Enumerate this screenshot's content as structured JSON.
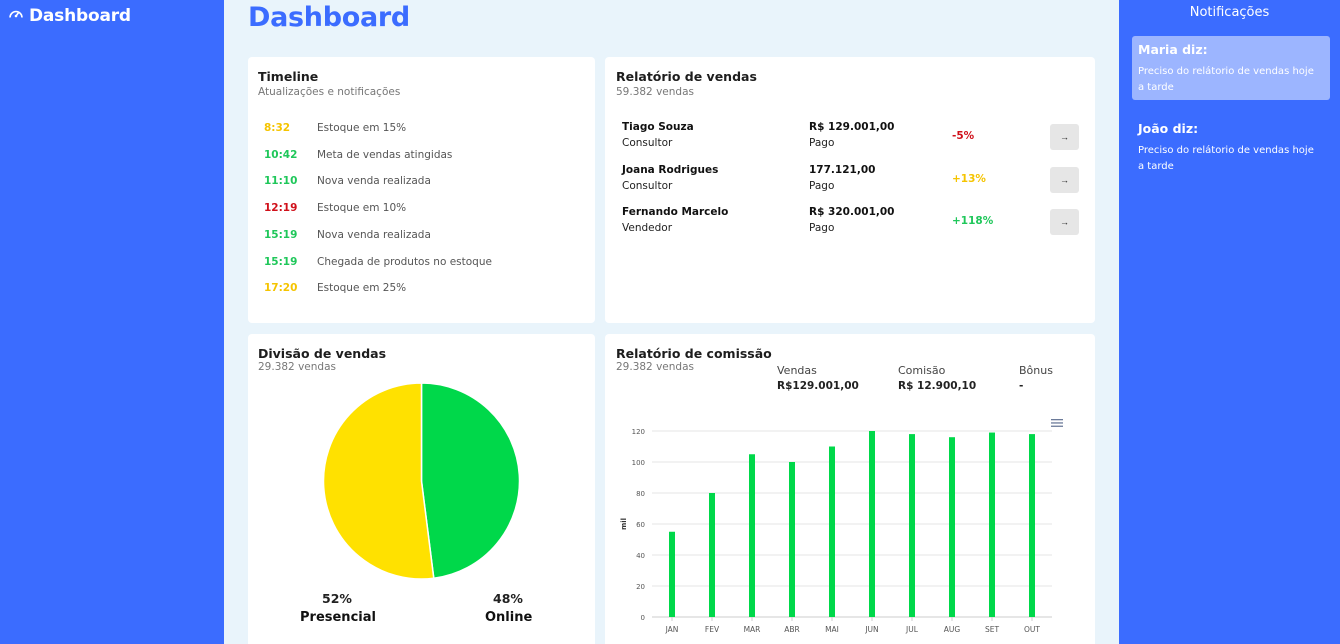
{
  "app": {
    "brand": "Dashboard",
    "page_title": "Dashboard"
  },
  "timeline": {
    "title": "Timeline",
    "subtitle": "Atualizações e notificações",
    "items": [
      {
        "time": "8:32",
        "text": "Estoque em 15%",
        "color": "#f5c400"
      },
      {
        "time": "10:42",
        "text": "Meta de vendas atingidas",
        "color": "#1fc75a"
      },
      {
        "time": "11:10",
        "text": "Nova venda realizada",
        "color": "#1fc75a"
      },
      {
        "time": "12:19",
        "text": "Estoque em 10%",
        "color": "#d0101a"
      },
      {
        "time": "15:19",
        "text": "Nova venda realizada",
        "color": "#1fc75a"
      },
      {
        "time": "15:19",
        "text": "Chegada de produtos no estoque",
        "color": "#1fc75a"
      },
      {
        "time": "17:20",
        "text": "Estoque em 25%",
        "color": "#f5c400"
      }
    ]
  },
  "sales_report": {
    "title": "Relatório de vendas",
    "subtitle": "59.382 vendas",
    "button_icon": "arrow-right-icon",
    "rows": [
      {
        "name": "Tiago Souza",
        "role": "Consultor",
        "amount": "R$ 129.001,00",
        "status": "Pago",
        "change": "-5%",
        "change_color": "#d0101a"
      },
      {
        "name": "Joana Rodrigues",
        "role": "Consultor",
        "amount": "177.121,00",
        "status": "Pago",
        "change": "+13%",
        "change_color": "#f5c400"
      },
      {
        "name": "Fernando Marcelo",
        "role": "Vendedor",
        "amount": "R$ 320.001,00",
        "status": "Pago",
        "change": "+118%",
        "change_color": "#1fc75a"
      }
    ]
  },
  "sales_division": {
    "title": "Divisão de vendas",
    "subtitle": "29.382 vendas",
    "segments": [
      {
        "label": "Presencial",
        "pct": "52%",
        "value": 52,
        "color": "#ffe100",
        "pct_color": "#f5c400"
      },
      {
        "label": "Online",
        "pct": "48%",
        "value": 48,
        "color": "#00d84a",
        "pct_color": "#1fc75a"
      }
    ]
  },
  "commission_report": {
    "title": "Relatório de comissão",
    "subtitle": "29.382 vendas",
    "summary": [
      {
        "label": "Vendas",
        "value": "R$129.001,00"
      },
      {
        "label": "Comisão",
        "value": "R$ 12.900,10"
      },
      {
        "label": "Bônus",
        "value": "-"
      }
    ],
    "menu_icon": "hamburger-menu-icon"
  },
  "chart_data": {
    "type": "bar",
    "categories": [
      "JAN",
      "FEV",
      "MAR",
      "ABR",
      "MAI",
      "JUN",
      "JUL",
      "AUG",
      "SET",
      "OUT"
    ],
    "values": [
      55,
      80,
      105,
      100,
      110,
      120,
      118,
      116,
      119,
      118
    ],
    "ylabel": "mil",
    "ylim": [
      0,
      120
    ],
    "yticks": [
      0,
      20,
      40,
      60,
      80,
      100,
      120
    ],
    "grid": true,
    "color": "#00d84a"
  },
  "notifications": {
    "title": "Notificações",
    "items": [
      {
        "author": "Maria diz:",
        "message": "Preciso do relátorio de vendas hoje a tarde"
      },
      {
        "author": "João diz:",
        "message": "Preciso do relátorio de vendas hoje a tarde"
      }
    ]
  },
  "colors": {
    "primary": "#3b6cff",
    "background": "#e9f4fb"
  }
}
